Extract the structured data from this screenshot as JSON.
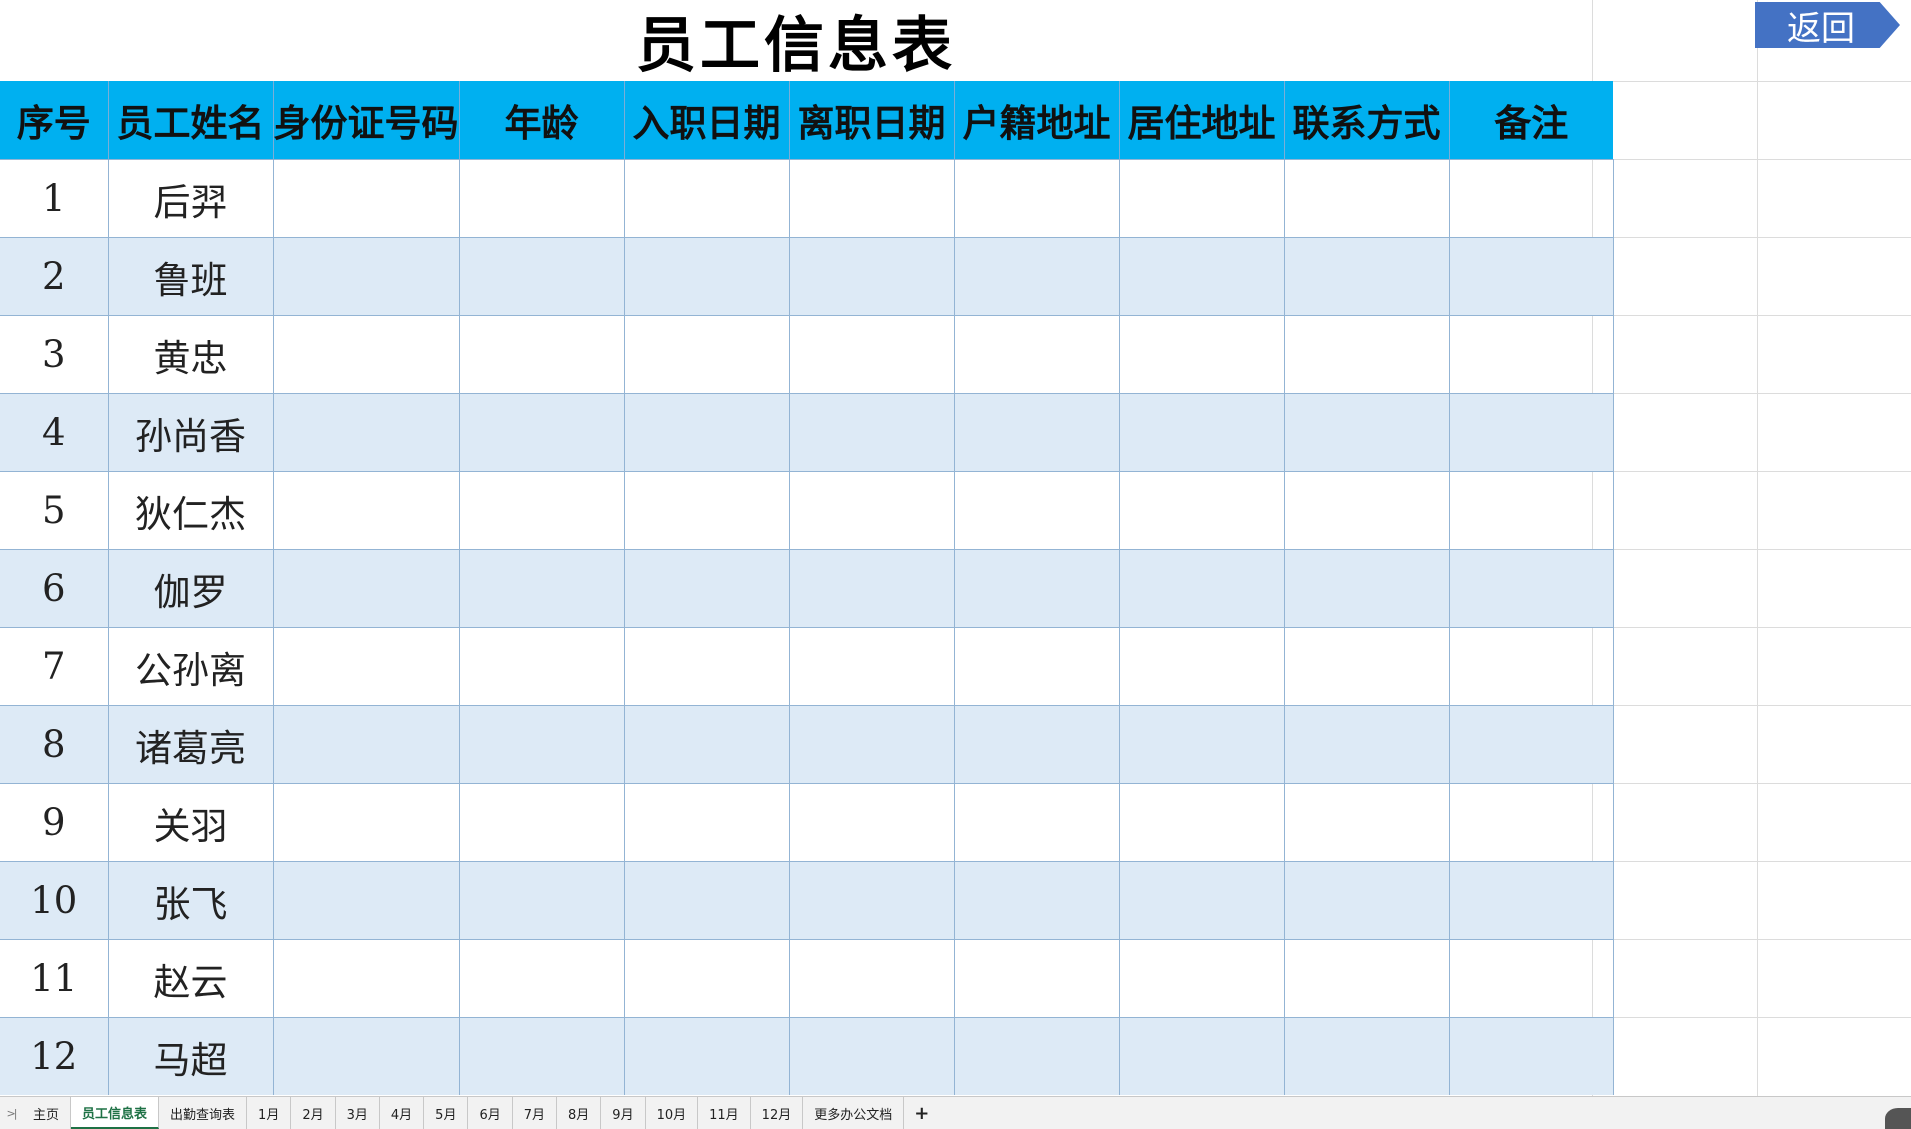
{
  "title": "员工信息表",
  "back_button": "返回",
  "columns": [
    "序号",
    "员工姓名",
    "身份证号码",
    "年龄",
    "入职日期",
    "离职日期",
    "户籍地址",
    "居住地址",
    "联系方式",
    "备注"
  ],
  "rows": [
    [
      "1",
      "后羿",
      "",
      "",
      "",
      "",
      "",
      "",
      "",
      ""
    ],
    [
      "2",
      "鲁班",
      "",
      "",
      "",
      "",
      "",
      "",
      "",
      ""
    ],
    [
      "3",
      "黄忠",
      "",
      "",
      "",
      "",
      "",
      "",
      "",
      ""
    ],
    [
      "4",
      "孙尚香",
      "",
      "",
      "",
      "",
      "",
      "",
      "",
      ""
    ],
    [
      "5",
      "狄仁杰",
      "",
      "",
      "",
      "",
      "",
      "",
      "",
      ""
    ],
    [
      "6",
      "伽罗",
      "",
      "",
      "",
      "",
      "",
      "",
      "",
      ""
    ],
    [
      "7",
      "公孙离",
      "",
      "",
      "",
      "",
      "",
      "",
      "",
      ""
    ],
    [
      "8",
      "诸葛亮",
      "",
      "",
      "",
      "",
      "",
      "",
      "",
      ""
    ],
    [
      "9",
      "关羽",
      "",
      "",
      "",
      "",
      "",
      "",
      "",
      ""
    ],
    [
      "10",
      "张飞",
      "",
      "",
      "",
      "",
      "",
      "",
      "",
      ""
    ],
    [
      "11",
      "赵云",
      "",
      "",
      "",
      "",
      "",
      "",
      "",
      ""
    ],
    [
      "12",
      "马超",
      "",
      "",
      "",
      "",
      "",
      "",
      "",
      ""
    ]
  ],
  "sheet_tabs": [
    "主页",
    "员工信息表",
    "出勤查询表",
    "1月",
    "2月",
    "3月",
    "4月",
    "5月",
    "6月",
    "7月",
    "8月",
    "9月",
    "10月",
    "11月",
    "12月",
    "更多办公文档"
  ],
  "active_tab": "员工信息表",
  "add_tab_icon": "+",
  "colors": {
    "header_bg": "#00b0f0",
    "stripe_bg": "#ddeaf6",
    "back_button_bg": "#4472c4",
    "active_tab_text": "#1e7145"
  },
  "icons": [
    "sheet-nav-icon",
    "add-sheet-icon",
    "back-arrow-shape"
  ]
}
